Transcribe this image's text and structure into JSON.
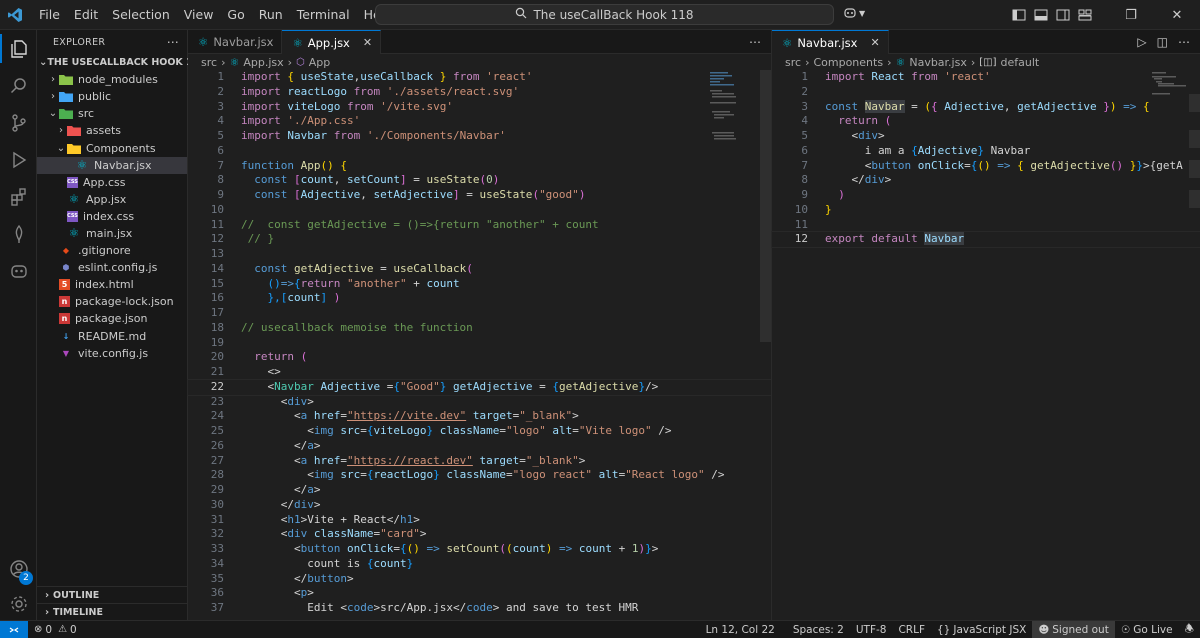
{
  "titlebar": {
    "menu": [
      "File",
      "Edit",
      "Selection",
      "View",
      "Go",
      "Run",
      "Terminal",
      "Help"
    ],
    "search": "The useCallBack Hook 118"
  },
  "sidebar": {
    "header": "EXPLORER",
    "root": "THE USECALLBACK HOOK 118",
    "items": [
      {
        "label": "node_modules",
        "depth": 1,
        "kind": "folder",
        "icon": "node-folder-icon",
        "color": "#8bc34a",
        "open": false
      },
      {
        "label": "public",
        "depth": 1,
        "kind": "folder",
        "icon": "public-folder-icon",
        "color": "#42a5f5",
        "open": false
      },
      {
        "label": "src",
        "depth": 1,
        "kind": "folder",
        "icon": "src-folder-icon",
        "color": "#4caf50",
        "open": true
      },
      {
        "label": "assets",
        "depth": 2,
        "kind": "folder",
        "icon": "assets-folder-icon",
        "color": "#ef5350",
        "open": false
      },
      {
        "label": "Components",
        "depth": 2,
        "kind": "folder",
        "icon": "components-folder-icon",
        "color": "#ffca28",
        "open": true
      },
      {
        "label": "Navbar.jsx",
        "depth": 3,
        "kind": "file",
        "icon": "react-file-icon",
        "color": "#00bcd4",
        "selected": true
      },
      {
        "label": "App.css",
        "depth": 2,
        "kind": "file",
        "icon": "css-file-icon",
        "color": "#7e57c2"
      },
      {
        "label": "App.jsx",
        "depth": 2,
        "kind": "file",
        "icon": "react-file-icon",
        "color": "#00bcd4"
      },
      {
        "label": "index.css",
        "depth": 2,
        "kind": "file",
        "icon": "css-file-icon",
        "color": "#7e57c2"
      },
      {
        "label": "main.jsx",
        "depth": 2,
        "kind": "file",
        "icon": "react-file-icon",
        "color": "#00bcd4"
      },
      {
        "label": ".gitignore",
        "depth": 1,
        "kind": "file",
        "icon": "git-file-icon",
        "color": "#e64a19"
      },
      {
        "label": "eslint.config.js",
        "depth": 1,
        "kind": "file",
        "icon": "eslint-file-icon",
        "color": "#7986cb"
      },
      {
        "label": "index.html",
        "depth": 1,
        "kind": "file",
        "icon": "html-file-icon",
        "color": "#e44d26"
      },
      {
        "label": "package-lock.json",
        "depth": 1,
        "kind": "file",
        "icon": "npm-file-icon",
        "color": "#cb3837"
      },
      {
        "label": "package.json",
        "depth": 1,
        "kind": "file",
        "icon": "npm-file-icon",
        "color": "#cb3837"
      },
      {
        "label": "README.md",
        "depth": 1,
        "kind": "file",
        "icon": "markdown-file-icon",
        "color": "#42a5f5"
      },
      {
        "label": "vite.config.js",
        "depth": 1,
        "kind": "file",
        "icon": "vite-file-icon",
        "color": "#ab47bc"
      }
    ],
    "outline": "OUTLINE",
    "timeline": "TIMELINE"
  },
  "activity": {
    "accounts_badge": "2"
  },
  "left_editor": {
    "tabs": [
      {
        "label": "Navbar.jsx",
        "active": false
      },
      {
        "label": "App.jsx",
        "active": true
      }
    ],
    "breadcrumb": [
      "src",
      "App.jsx",
      "App"
    ],
    "current_line": 22
  },
  "right_editor": {
    "tabs": [
      {
        "label": "Navbar.jsx",
        "active": true
      }
    ],
    "breadcrumb": [
      "src",
      "Components",
      "Navbar.jsx",
      "default"
    ],
    "current_line": 12
  },
  "status": {
    "errors": "0",
    "warnings": "0",
    "position": "Ln 12, Col 22",
    "spaces": "Spaces: 2",
    "encoding": "UTF-8",
    "eol": "CRLF",
    "language": "JavaScript JSX",
    "signed": "Signed out",
    "golive": "Go Live"
  },
  "app_code": [
    [
      [
        "import ",
        "c"
      ],
      [
        "{ ",
        "y"
      ],
      [
        "useState",
        "v"
      ],
      [
        ",",
        "p"
      ],
      [
        "useCallback",
        "v"
      ],
      [
        " }",
        "y"
      ],
      [
        " from ",
        "c"
      ],
      [
        "'react'",
        "s"
      ]
    ],
    [
      [
        "import ",
        "c"
      ],
      [
        "reactLogo",
        "v"
      ],
      [
        " from ",
        "c"
      ],
      [
        "'./assets/react.svg'",
        "s"
      ]
    ],
    [
      [
        "import ",
        "c"
      ],
      [
        "viteLogo",
        "v"
      ],
      [
        " from ",
        "c"
      ],
      [
        "'/vite.svg'",
        "s"
      ]
    ],
    [
      [
        "import ",
        "c"
      ],
      [
        "'./App.css'",
        "s"
      ]
    ],
    [
      [
        "import ",
        "c"
      ],
      [
        "Navbar",
        "v"
      ],
      [
        " from ",
        "c"
      ],
      [
        "'./Components/Navbar'",
        "s"
      ]
    ],
    [],
    [
      [
        "function ",
        "k"
      ],
      [
        "App",
        "f"
      ],
      [
        "() ",
        "y"
      ],
      [
        "{",
        "y"
      ]
    ],
    [
      [
        "  const ",
        "k"
      ],
      [
        "[",
        "pk"
      ],
      [
        "count",
        "v"
      ],
      [
        ", ",
        "p"
      ],
      [
        "setCount",
        "v"
      ],
      [
        "]",
        "pk"
      ],
      [
        " = ",
        "p"
      ],
      [
        "useState",
        "f"
      ],
      [
        "(",
        "pk"
      ],
      [
        "0",
        "n"
      ],
      [
        ")",
        "pk"
      ]
    ],
    [
      [
        "  const ",
        "k"
      ],
      [
        "[",
        "pk"
      ],
      [
        "Adjective",
        "v"
      ],
      [
        ", ",
        "p"
      ],
      [
        "setAdjective",
        "v"
      ],
      [
        "]",
        "pk"
      ],
      [
        " = ",
        "p"
      ],
      [
        "useState",
        "f"
      ],
      [
        "(",
        "pk"
      ],
      [
        "\"good\"",
        "s"
      ],
      [
        ")",
        "pk"
      ]
    ],
    [],
    [
      [
        "//  const getAdjective = ()=>{return \"another\" + count",
        "cm"
      ]
    ],
    [
      [
        " // }",
        "cm"
      ]
    ],
    [],
    [
      [
        "  const ",
        "k"
      ],
      [
        "getAdjective",
        "f"
      ],
      [
        " = ",
        "p"
      ],
      [
        "useCallback",
        "f"
      ],
      [
        "(",
        "pk"
      ]
    ],
    [
      [
        "    ",
        "p"
      ],
      [
        "()",
        "bl"
      ],
      [
        "=>",
        "k"
      ],
      [
        "{",
        "bl"
      ],
      [
        "return ",
        "c"
      ],
      [
        "\"another\"",
        "s"
      ],
      [
        " + ",
        "p"
      ],
      [
        "count",
        "v"
      ]
    ],
    [
      [
        "    ",
        "p"
      ],
      [
        "},",
        "bl"
      ],
      [
        "[",
        "bl"
      ],
      [
        "count",
        "v"
      ],
      [
        "]",
        "bl"
      ],
      [
        " )",
        "pk"
      ]
    ],
    [],
    [
      [
        "// usecallback memoise the function",
        "cm"
      ]
    ],
    [],
    [
      [
        "  return ",
        "c"
      ],
      [
        "(",
        "pk"
      ]
    ],
    [
      [
        "    <>",
        "p"
      ]
    ],
    [
      [
        "    <",
        "p"
      ],
      [
        "Navbar",
        "t"
      ],
      [
        " Adjective",
        "v"
      ],
      [
        " =",
        "p"
      ],
      [
        "{",
        "bl"
      ],
      [
        "\"Good\"",
        "s"
      ],
      [
        "}",
        "bl"
      ],
      [
        " getAdjective",
        "v"
      ],
      [
        " = ",
        "p"
      ],
      [
        "{",
        "bl"
      ],
      [
        "getAdjective",
        "f"
      ],
      [
        "}",
        "bl"
      ],
      [
        "/>",
        "p"
      ]
    ],
    [
      [
        "      <",
        "p"
      ],
      [
        "div",
        "k"
      ],
      [
        ">",
        "p"
      ]
    ],
    [
      [
        "        <",
        "p"
      ],
      [
        "a",
        "k"
      ],
      [
        " href",
        "v"
      ],
      [
        "=",
        "p"
      ],
      [
        "\"https://vite.dev\"",
        "s"
      ],
      [
        " target",
        "v"
      ],
      [
        "=",
        "p"
      ],
      [
        "\"_blank\"",
        "s"
      ],
      [
        ">",
        "p"
      ]
    ],
    [
      [
        "          <",
        "p"
      ],
      [
        "img",
        "k"
      ],
      [
        " src",
        "v"
      ],
      [
        "=",
        "p"
      ],
      [
        "{",
        "bl"
      ],
      [
        "viteLogo",
        "v"
      ],
      [
        "}",
        "bl"
      ],
      [
        " className",
        "v"
      ],
      [
        "=",
        "p"
      ],
      [
        "\"logo\"",
        "s"
      ],
      [
        " alt",
        "v"
      ],
      [
        "=",
        "p"
      ],
      [
        "\"Vite logo\"",
        "s"
      ],
      [
        " />",
        "p"
      ]
    ],
    [
      [
        "        </",
        "p"
      ],
      [
        "a",
        "k"
      ],
      [
        ">",
        "p"
      ]
    ],
    [
      [
        "        <",
        "p"
      ],
      [
        "a",
        "k"
      ],
      [
        " href",
        "v"
      ],
      [
        "=",
        "p"
      ],
      [
        "\"https://react.dev\"",
        "s"
      ],
      [
        " target",
        "v"
      ],
      [
        "=",
        "p"
      ],
      [
        "\"_blank\"",
        "s"
      ],
      [
        ">",
        "p"
      ]
    ],
    [
      [
        "          <",
        "p"
      ],
      [
        "img",
        "k"
      ],
      [
        " src",
        "v"
      ],
      [
        "=",
        "p"
      ],
      [
        "{",
        "bl"
      ],
      [
        "reactLogo",
        "v"
      ],
      [
        "}",
        "bl"
      ],
      [
        " className",
        "v"
      ],
      [
        "=",
        "p"
      ],
      [
        "\"logo react\"",
        "s"
      ],
      [
        " alt",
        "v"
      ],
      [
        "=",
        "p"
      ],
      [
        "\"React logo\"",
        "s"
      ],
      [
        " />",
        "p"
      ]
    ],
    [
      [
        "        </",
        "p"
      ],
      [
        "a",
        "k"
      ],
      [
        ">",
        "p"
      ]
    ],
    [
      [
        "      </",
        "p"
      ],
      [
        "div",
        "k"
      ],
      [
        ">",
        "p"
      ]
    ],
    [
      [
        "      <",
        "p"
      ],
      [
        "h1",
        "k"
      ],
      [
        ">",
        "p"
      ],
      [
        "Vite + React",
        "p"
      ],
      [
        "</",
        "p"
      ],
      [
        "h1",
        "k"
      ],
      [
        ">",
        "p"
      ]
    ],
    [
      [
        "      <",
        "p"
      ],
      [
        "div",
        "k"
      ],
      [
        " className",
        "v"
      ],
      [
        "=",
        "p"
      ],
      [
        "\"card\"",
        "s"
      ],
      [
        ">",
        "p"
      ]
    ],
    [
      [
        "        <",
        "p"
      ],
      [
        "button",
        "k"
      ],
      [
        " onClick",
        "v"
      ],
      [
        "=",
        "p"
      ],
      [
        "{",
        "bl"
      ],
      [
        "() ",
        "y"
      ],
      [
        "=> ",
        "k"
      ],
      [
        "setCount",
        "f"
      ],
      [
        "(",
        "pk"
      ],
      [
        "(",
        "y"
      ],
      [
        "count",
        "v"
      ],
      [
        ") ",
        "y"
      ],
      [
        "=> ",
        "k"
      ],
      [
        "count",
        "v"
      ],
      [
        " + ",
        "p"
      ],
      [
        "1",
        "n"
      ],
      [
        ")",
        "pk"
      ],
      [
        "}",
        "bl"
      ],
      [
        ">",
        "p"
      ]
    ],
    [
      [
        "          count is ",
        "p"
      ],
      [
        "{",
        "bl"
      ],
      [
        "count",
        "v"
      ],
      [
        "}",
        "bl"
      ]
    ],
    [
      [
        "        </",
        "p"
      ],
      [
        "button",
        "k"
      ],
      [
        ">",
        "p"
      ]
    ],
    [
      [
        "        <",
        "p"
      ],
      [
        "p",
        "k"
      ],
      [
        ">",
        "p"
      ]
    ],
    [
      [
        "          Edit <",
        "p"
      ],
      [
        "code",
        "k"
      ],
      [
        ">",
        "p"
      ],
      [
        "src/App.jsx",
        "p"
      ],
      [
        "</",
        "p"
      ],
      [
        "code",
        "k"
      ],
      [
        "> and save to test HMR",
        "p"
      ]
    ]
  ],
  "navbar_code": [
    [
      [
        "import ",
        "c"
      ],
      [
        "React",
        "v"
      ],
      [
        " from ",
        "c"
      ],
      [
        "'react'",
        "s"
      ]
    ],
    [],
    [
      [
        "const ",
        "k"
      ],
      [
        "Navbar",
        "f"
      ],
      [
        " = ",
        "p"
      ],
      [
        "(",
        "y"
      ],
      [
        "{ ",
        "pk"
      ],
      [
        "Adjective",
        "v"
      ],
      [
        ", ",
        "p"
      ],
      [
        "getAdjective",
        "v"
      ],
      [
        " }",
        "pk"
      ],
      [
        ") ",
        "y"
      ],
      [
        "=> ",
        "k"
      ],
      [
        "{",
        "y"
      ]
    ],
    [
      [
        "  return ",
        "c"
      ],
      [
        "(",
        "pk"
      ]
    ],
    [
      [
        "    <",
        "p"
      ],
      [
        "div",
        "k"
      ],
      [
        ">",
        "p"
      ]
    ],
    [
      [
        "      i am a ",
        "p"
      ],
      [
        "{",
        "bl"
      ],
      [
        "Adjective",
        "v"
      ],
      [
        "}",
        "bl"
      ],
      [
        " Navbar",
        "p"
      ]
    ],
    [
      [
        "      <",
        "p"
      ],
      [
        "button",
        "k"
      ],
      [
        " onClick",
        "v"
      ],
      [
        "=",
        "p"
      ],
      [
        "{",
        "bl"
      ],
      [
        "() ",
        "y"
      ],
      [
        "=> ",
        "k"
      ],
      [
        "{ ",
        "y"
      ],
      [
        "getAdjective",
        "f"
      ],
      [
        "() ",
        "pk"
      ],
      [
        "}",
        "y"
      ],
      [
        "}",
        "bl"
      ],
      [
        ">{getA",
        "p"
      ]
    ],
    [
      [
        "    </",
        "p"
      ],
      [
        "div",
        "k"
      ],
      [
        ">",
        "p"
      ]
    ],
    [
      [
        "  )",
        "pk"
      ]
    ],
    [
      [
        "}",
        "y"
      ]
    ],
    [],
    [
      [
        "export ",
        "c"
      ],
      [
        "default ",
        "c"
      ],
      [
        "Navbar",
        "v"
      ]
    ]
  ]
}
